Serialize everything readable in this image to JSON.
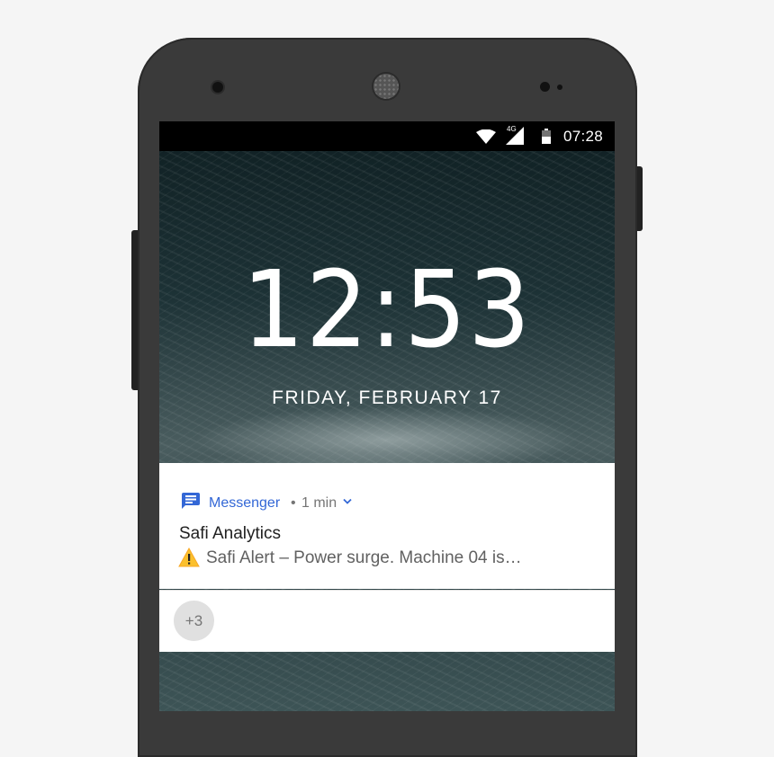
{
  "statusbar": {
    "network": "4G",
    "time": "07:28",
    "icons": [
      "wifi-icon",
      "cell-signal-icon",
      "battery-icon"
    ]
  },
  "lockscreen": {
    "clock": "12:53",
    "date": "FRIDAY, FEBRUARY 17"
  },
  "notification": {
    "app_icon": "messenger-icon",
    "app_name": "Messenger",
    "separator": "•",
    "time": "1 min",
    "title": "Safi Analytics",
    "warning_icon": "warning-icon",
    "body": "Safi Alert – Power surge. Machine 04 is…"
  },
  "more_notifications": {
    "count_label": "+3"
  },
  "colors": {
    "accent": "#3367d6",
    "warning": "#fbc02d"
  }
}
